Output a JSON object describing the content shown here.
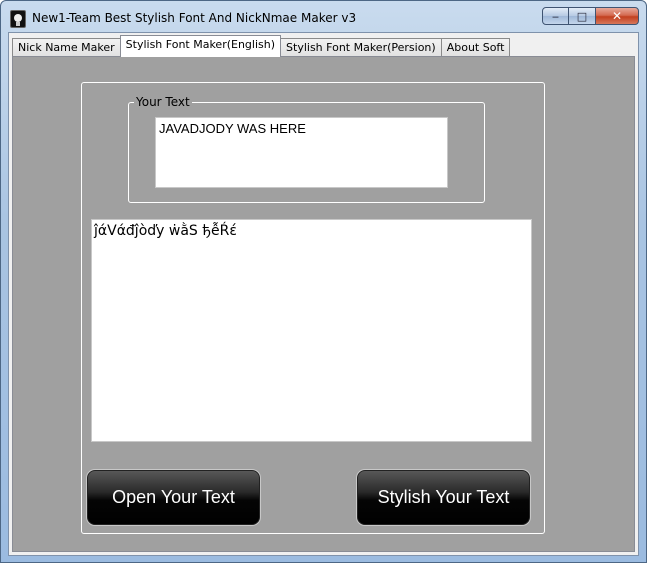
{
  "window": {
    "title": "New1-Team Best Stylish Font And NickNmae Maker v3",
    "minimize_glyph": "‒",
    "maximize_glyph": "□",
    "close_glyph": "✕"
  },
  "tabs": [
    {
      "label": "Nick Name Maker",
      "active": false
    },
    {
      "label": "Stylish Font Maker(English)",
      "active": true
    },
    {
      "label": "Stylish Font Maker(Persion)",
      "active": false
    },
    {
      "label": "About Soft",
      "active": false
    }
  ],
  "input_group": {
    "legend": "Your Text",
    "value": "JAVADJODY WAS HERE"
  },
  "output": {
    "value": "ĵάVάđĵòďy ẇằS ђễŔέ"
  },
  "buttons": {
    "open_label": "Open Your Text",
    "stylish_label": "Stylish Your Text"
  },
  "colors": {
    "tab_page_background": "#a0a0a0",
    "button_background": "#000000",
    "button_text": "#ffffff"
  }
}
